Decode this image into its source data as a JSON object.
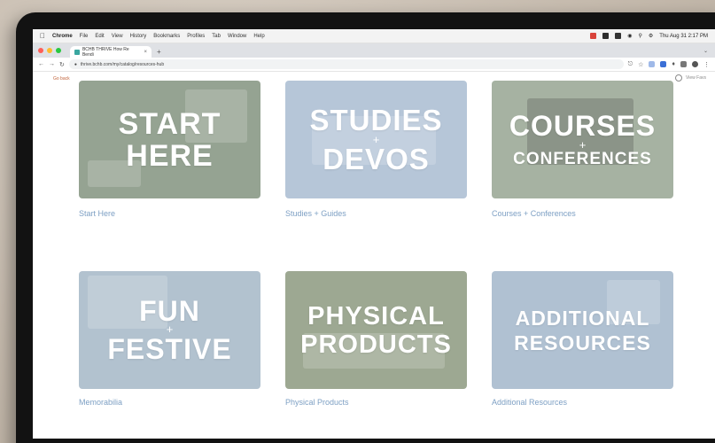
{
  "menubar": {
    "app": "Chrome",
    "items": [
      "File",
      "Edit",
      "View",
      "History",
      "Bookmarks",
      "Profiles",
      "Tab",
      "Window",
      "Help"
    ],
    "clock": "Thu Aug 31  2:17 PM"
  },
  "browser": {
    "tab_title": "BCHB THRIVE How Re Bendi",
    "new_tab": "+",
    "url": "thrive.bchb.com/my/catalog/resources-hub"
  },
  "page": {
    "back_label": "Go back",
    "favorites_label": "View Favs",
    "cards": [
      {
        "line1": "START",
        "line2": "HERE",
        "caption": "Start Here"
      },
      {
        "line1": "STUDIES",
        "plus": "+",
        "line2": "DEVOS",
        "caption": "Studies + Guides"
      },
      {
        "line1": "COURSES",
        "plus": "+",
        "line2": "CONFERENCES",
        "caption": "Courses + Conferences"
      },
      {
        "line1": "FUN",
        "plus": "+",
        "line2": "FESTIVE",
        "caption": "Memorabilia"
      },
      {
        "line1": "PHYSICAL",
        "line2": "PRODUCTS",
        "caption": "Physical Products"
      },
      {
        "line1": "ADDITIONAL",
        "line2": "RESOURCES",
        "caption": "Additional Resources"
      }
    ]
  },
  "colors": {
    "accent": "#c0623a",
    "caption": "#7ea0c4",
    "card_sage": "#95a392",
    "card_blue": "#b6c6d8",
    "card_green": "#a6b2a2"
  }
}
